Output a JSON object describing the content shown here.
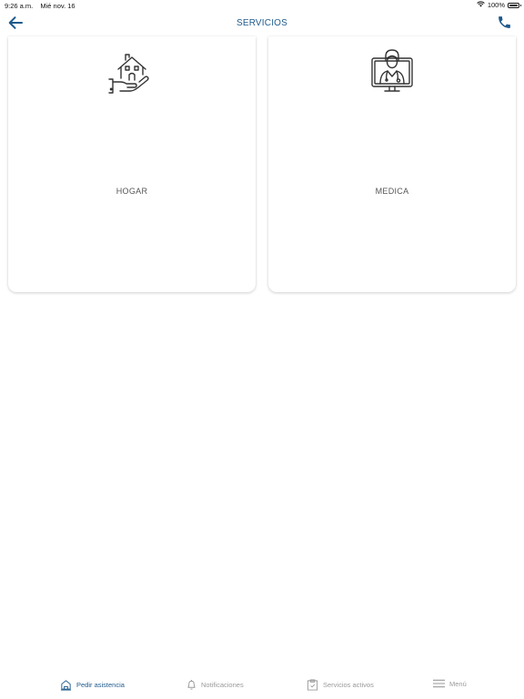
{
  "status_bar": {
    "time": "9:26 a.m.",
    "date": "Mié nov. 16",
    "battery": "100%",
    "battery_level": 1.0
  },
  "header": {
    "title": "SERVICIOS",
    "back_icon": "arrow-left-icon",
    "call_icon": "phone-icon"
  },
  "services": [
    {
      "label": "HOGAR",
      "icon": "home-hand-icon"
    },
    {
      "label": "MEDICA",
      "icon": "doctor-monitor-icon"
    }
  ],
  "tab_bar": {
    "tabs": [
      {
        "label": "Pedir asistencia",
        "icon": "assistance-icon",
        "active": true
      },
      {
        "label": "Notificaciones",
        "icon": "bell-icon",
        "active": false
      },
      {
        "label": "Servicios activos",
        "icon": "clipboard-icon",
        "active": false
      },
      {
        "label": "Menú",
        "icon": "menu-icon",
        "active": false
      }
    ]
  },
  "colors": {
    "accent": "#1e5a8c",
    "inactive": "#9a9a9a"
  }
}
